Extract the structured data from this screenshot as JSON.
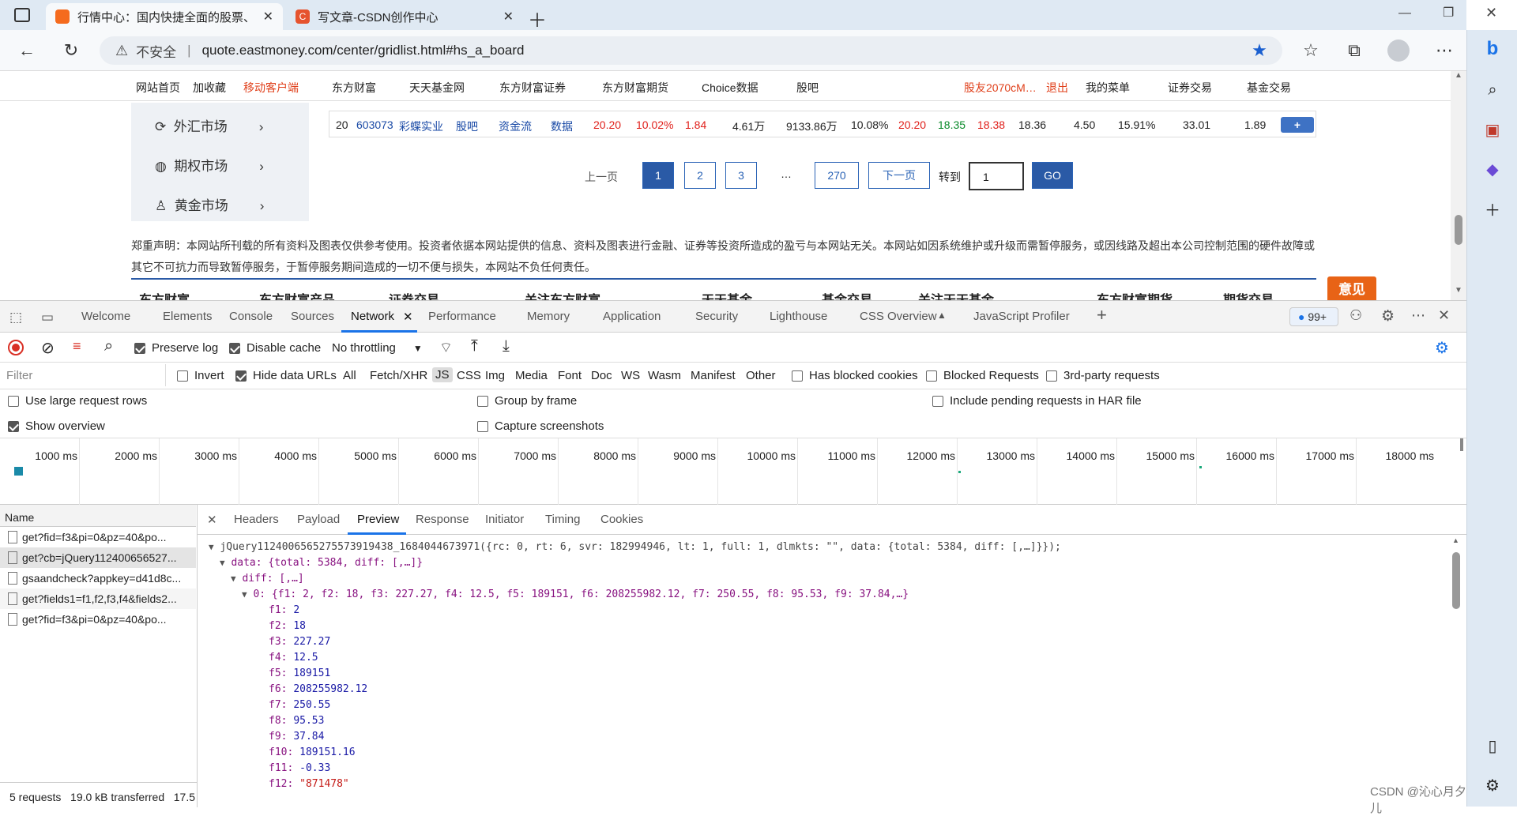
{
  "browser": {
    "tabs": [
      {
        "title": "行情中心：国内快捷全面的股票、",
        "active": true
      },
      {
        "title": "写文章-CSDN创作中心",
        "active": false
      }
    ],
    "security_label": "不安全",
    "url": "quote.eastmoney.com/center/gridlist.html#hs_a_board"
  },
  "site_nav": {
    "items": [
      "网站首页",
      "加收藏",
      "移动客户端",
      "东方财富",
      "天天基金网",
      "东方财富证券",
      "东方财富期货",
      "Choice数据",
      "股吧",
      "股友2070cM…",
      "退出",
      "我的菜单",
      "证券交易",
      "基金交易"
    ]
  },
  "left_menu": [
    "外汇市场",
    "期权市场",
    "黄金市场"
  ],
  "stock_row": {
    "cells": [
      "20",
      "603073",
      "彩蝶实业",
      "股吧",
      "资金流",
      "数据",
      "20.20",
      "10.02%",
      "1.84",
      "4.61万",
      "9133.86万",
      "10.08%",
      "20.20",
      "18.35",
      "18.38",
      "18.36",
      "4.50",
      "15.91%",
      "33.01",
      "1.89"
    ]
  },
  "pagination": {
    "prev": "上一页",
    "pages": [
      "1",
      "2",
      "3"
    ],
    "ellipsis": "…",
    "last": "270",
    "next": "下一页",
    "goto": "转到",
    "goto_value": "1",
    "go": "GO"
  },
  "disclaimer": "郑重声明：本网站所刊载的所有资料及图表仅供参考使用。投资者依据本网站提供的信息、资料及图表进行金融、证券等投资所造成的盈亏与本网站无关。本网站如因系统维护或升级而需暂停服务，或因线路及超出本公司控制范围的硬件故障或其它不可抗力而导致暂停服务，于暂停服务期间造成的一切不便与损失，本网站不负任何责任。",
  "footer_partial": [
    "东方财富",
    "东方财富产品",
    "证券交易",
    "关注东方财富",
    "天天基金",
    "基金交易",
    "关注天天基金",
    "东方财富期货",
    "期货交易"
  ],
  "feedback_btn": "意见",
  "devtools": {
    "tabs": [
      "Welcome",
      "Elements",
      "Console",
      "Sources",
      "Network",
      "Performance",
      "Memory",
      "Application",
      "Security",
      "Lighthouse",
      "CSS Overview",
      "JavaScript Profiler"
    ],
    "issues_badge": "99+",
    "toolbar": {
      "preserve_log": "Preserve log",
      "disable_cache": "Disable cache",
      "throttling": "No throttling"
    },
    "filter": {
      "placeholder": "Filter",
      "invert": "Invert",
      "hide_data_urls": "Hide data URLs",
      "types": [
        "All",
        "Fetch/XHR",
        "JS",
        "CSS",
        "Img",
        "Media",
        "Font",
        "Doc",
        "WS",
        "Wasm",
        "Manifest",
        "Other"
      ],
      "has_blocked": "Has blocked cookies",
      "blocked_requests": "Blocked Requests",
      "third_party": "3rd-party requests"
    },
    "settings": {
      "large_rows": "Use large request rows",
      "group_by_frame": "Group by frame",
      "pending_har": "Include pending requests in HAR file",
      "show_overview": "Show overview",
      "capture_screenshots": "Capture screenshots"
    },
    "timeline": [
      "1000 ms",
      "2000 ms",
      "3000 ms",
      "4000 ms",
      "5000 ms",
      "6000 ms",
      "7000 ms",
      "8000 ms",
      "9000 ms",
      "10000 ms",
      "11000 ms",
      "12000 ms",
      "13000 ms",
      "14000 ms",
      "15000 ms",
      "16000 ms",
      "17000 ms",
      "18000 ms"
    ],
    "name_header": "Name",
    "requests": [
      "get?fid=f3&pi=0&pz=40&po...",
      "get?cb=jQuery112400656527...",
      "gsaandcheck?appkey=d41d8c...",
      "get?fields1=f1,f2,f3,f4&fields2...",
      "get?fid=f3&pi=0&pz=40&po..."
    ],
    "status_bar": "5 requests   19.0 kB transferred   17.5",
    "detail_tabs": [
      "Headers",
      "Payload",
      "Preview",
      "Response",
      "Initiator",
      "Timing",
      "Cookies"
    ],
    "preview": {
      "line0": "jQuery1124006565275573919438_1684044673971({rc: 0, rt: 6, svr: 182994946, lt: 1, full: 1, dlmkts: \"\", data: {total: 5384, diff: [,…]}});",
      "data_line": "data: {total: 5384, diff: [,…]}",
      "diff_line": "diff: [,…]",
      "item0_line": "0: {f1: 2, f2: 18, f3: 227.27, f4: 12.5, f5: 189151, f6: 208255982.12, f7: 250.55, f8: 95.53, f9: 37.84,…}",
      "fields": [
        {
          "k": "f1",
          "v": "2"
        },
        {
          "k": "f2",
          "v": "18"
        },
        {
          "k": "f3",
          "v": "227.27"
        },
        {
          "k": "f4",
          "v": "12.5"
        },
        {
          "k": "f5",
          "v": "189151"
        },
        {
          "k": "f6",
          "v": "208255982.12"
        },
        {
          "k": "f7",
          "v": "250.55"
        },
        {
          "k": "f8",
          "v": "95.53"
        },
        {
          "k": "f9",
          "v": "37.84"
        },
        {
          "k": "f10",
          "v": "189151.16"
        },
        {
          "k": "f11",
          "v": "-0.33"
        },
        {
          "k": "f12",
          "v": "\"871478\""
        }
      ]
    }
  },
  "watermark": "CSDN @沁心月夕儿"
}
